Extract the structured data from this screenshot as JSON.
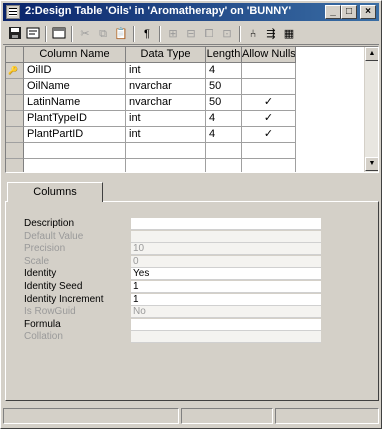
{
  "window": {
    "title": "2:Design Table 'Oils' in 'Aromatherapy' on 'BUNNY'",
    "controls": {
      "minimize": "_",
      "maximize": "□",
      "close": "×"
    }
  },
  "toolbar": {
    "icons": [
      "save-icon",
      "properties-icon",
      "new-table-icon",
      "cut-icon",
      "copy-icon",
      "paste-icon",
      "set-primary-key-icon",
      "insert-column-icon",
      "delete-column-icon",
      "relationships-icon",
      "manage-indexes-icon",
      "manage-constraints-icon",
      "manage-triggers-icon",
      "generate-script-icon"
    ]
  },
  "grid": {
    "columns": [
      "Column Name",
      "Data Type",
      "Length",
      "Allow Nulls"
    ],
    "rows": [
      {
        "key": "🔑",
        "name": "OilID",
        "type": "int",
        "length": "4",
        "nulls": ""
      },
      {
        "key": "",
        "name": "OilName",
        "type": "nvarchar",
        "length": "50",
        "nulls": ""
      },
      {
        "key": "",
        "name": "LatinName",
        "type": "nvarchar",
        "length": "50",
        "nulls": "✓"
      },
      {
        "key": "",
        "name": "PlantTypeID",
        "type": "int",
        "length": "4",
        "nulls": "✓"
      },
      {
        "key": "",
        "name": "PlantPartID",
        "type": "int",
        "length": "4",
        "nulls": "✓"
      },
      {
        "key": "",
        "name": "",
        "type": "",
        "length": "",
        "nulls": ""
      },
      {
        "key": "",
        "name": "",
        "type": "",
        "length": "",
        "nulls": ""
      }
    ],
    "scroll_up": "▲",
    "scroll_down": "▼"
  },
  "properties": {
    "tab_label": "Columns",
    "items": [
      {
        "label": "Description",
        "value": "",
        "disabled": false
      },
      {
        "label": "Default Value",
        "value": "",
        "disabled": true
      },
      {
        "label": "Precision",
        "value": "10",
        "disabled": true
      },
      {
        "label": "Scale",
        "value": "0",
        "disabled": true
      },
      {
        "label": "Identity",
        "value": "Yes",
        "disabled": false
      },
      {
        "label": "Identity Seed",
        "value": "1",
        "disabled": false
      },
      {
        "label": "Identity Increment",
        "value": "1",
        "disabled": false
      },
      {
        "label": "Is RowGuid",
        "value": "No",
        "disabled": true
      },
      {
        "label": "Formula",
        "value": "",
        "disabled": false
      },
      {
        "label": "Collation",
        "value": "",
        "disabled": true
      }
    ]
  }
}
